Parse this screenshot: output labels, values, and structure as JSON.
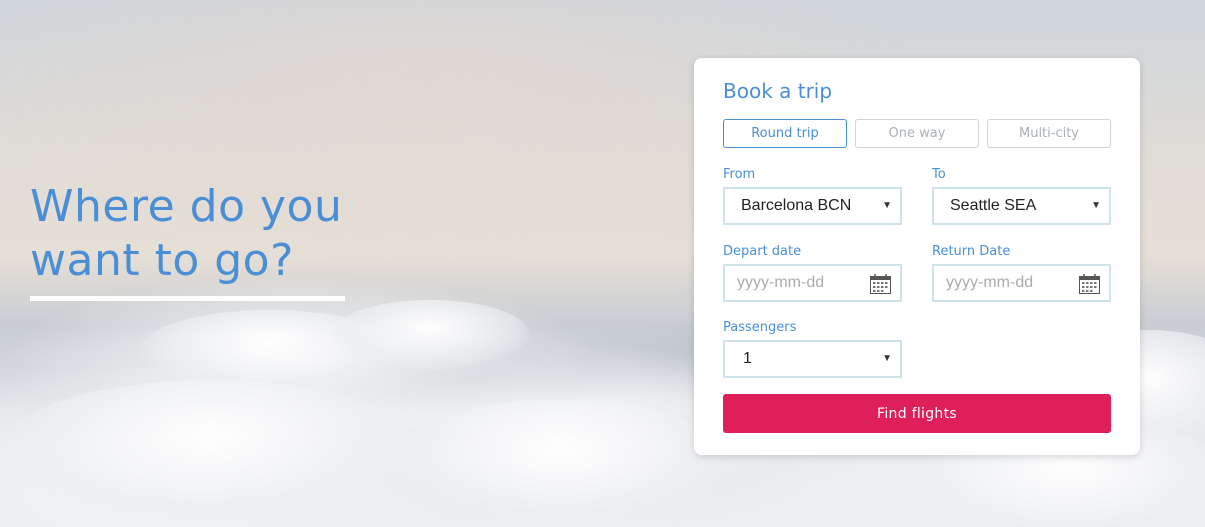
{
  "hero": {
    "headline_line1": "Where do you",
    "headline_line2": "want to go?"
  },
  "booking": {
    "title": "Book a trip",
    "trip_types": [
      "Round trip",
      "One way",
      "Multi-city"
    ],
    "selected_trip_type": "Round trip",
    "from": {
      "label": "From",
      "value": "Barcelona BCN"
    },
    "to": {
      "label": "To",
      "value": "Seattle SEA"
    },
    "depart": {
      "label": "Depart date",
      "placeholder": "yyyy-mm-dd"
    },
    "return": {
      "label": "Return Date",
      "placeholder": "yyyy-mm-dd"
    },
    "passengers": {
      "label": "Passengers",
      "value": "1"
    },
    "submit_label": "Find flights"
  },
  "colors": {
    "accent": "#4a8fd6",
    "cta": "#de1f5a",
    "input_border": "#cfe3ea"
  }
}
